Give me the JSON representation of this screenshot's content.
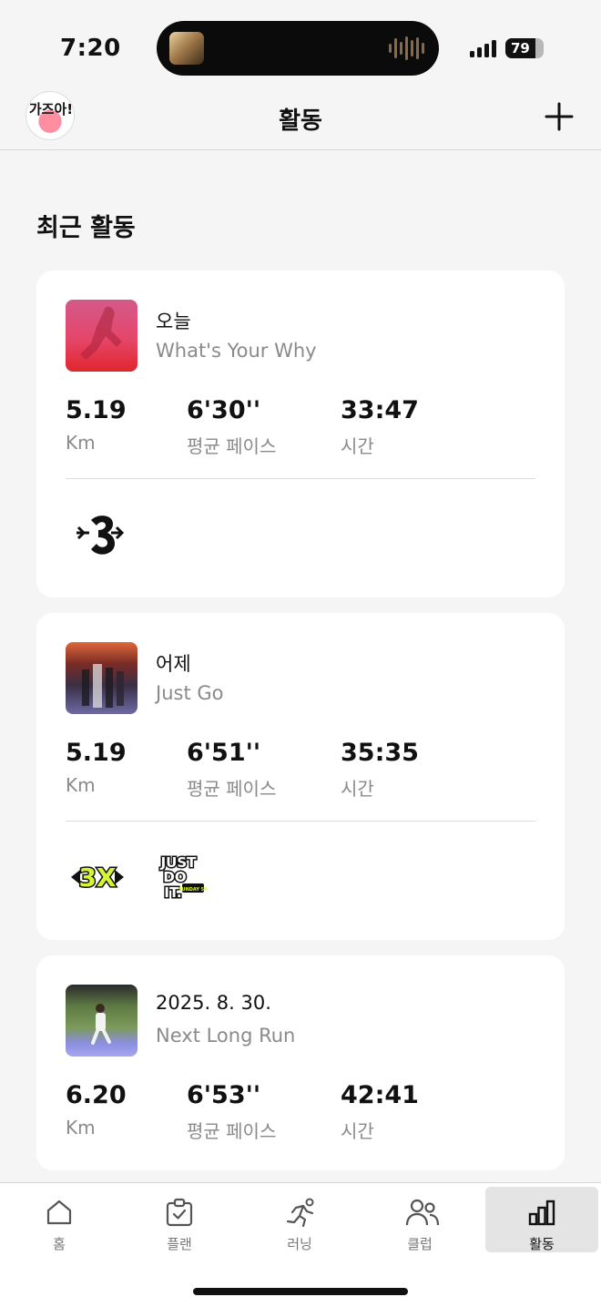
{
  "status_bar": {
    "time": "7:20",
    "battery": "79"
  },
  "nav": {
    "title": "활동",
    "avatar_text": "가즈아!"
  },
  "section_title": "최근 활동",
  "activities": [
    {
      "date": "오늘",
      "name": "What's Your Why",
      "distance": "5.19",
      "distance_unit": "Km",
      "pace": "6'30''",
      "pace_label": "평균 페이스",
      "duration": "33:47",
      "duration_label": "시간",
      "badges": [
        "3-arrow-badge-icon"
      ]
    },
    {
      "date": "어제",
      "name": "Just Go",
      "distance": "5.19",
      "distance_unit": "Km",
      "pace": "6'51''",
      "pace_label": "평균 페이스",
      "duration": "35:35",
      "duration_label": "시간",
      "badges": [
        "3x-arrow-badge-icon",
        "just-do-it-badge-icon"
      ],
      "badge_text": {
        "line1": "JUST",
        "line2": "DO",
        "line3": "IT.",
        "small": "SUNDAY 5K"
      }
    },
    {
      "date": "2025. 8. 30.",
      "name": "Next Long Run",
      "distance": "6.20",
      "distance_unit": "Km",
      "pace": "6'53''",
      "pace_label": "평균 페이스",
      "duration": "42:41",
      "duration_label": "시간"
    }
  ],
  "tabs": [
    {
      "label": "홈",
      "icon": "home-icon",
      "active": false
    },
    {
      "label": "플랜",
      "icon": "clipboard-check-icon",
      "active": false
    },
    {
      "label": "러닝",
      "icon": "runner-icon",
      "active": false
    },
    {
      "label": "클럽",
      "icon": "people-icon",
      "active": false
    },
    {
      "label": "활동",
      "icon": "bar-chart-icon",
      "active": true
    }
  ],
  "colors": {
    "accent_badge": "#d7f533",
    "background": "#f5f5f5",
    "card": "#ffffff",
    "muted_text": "#8a8a8a"
  }
}
